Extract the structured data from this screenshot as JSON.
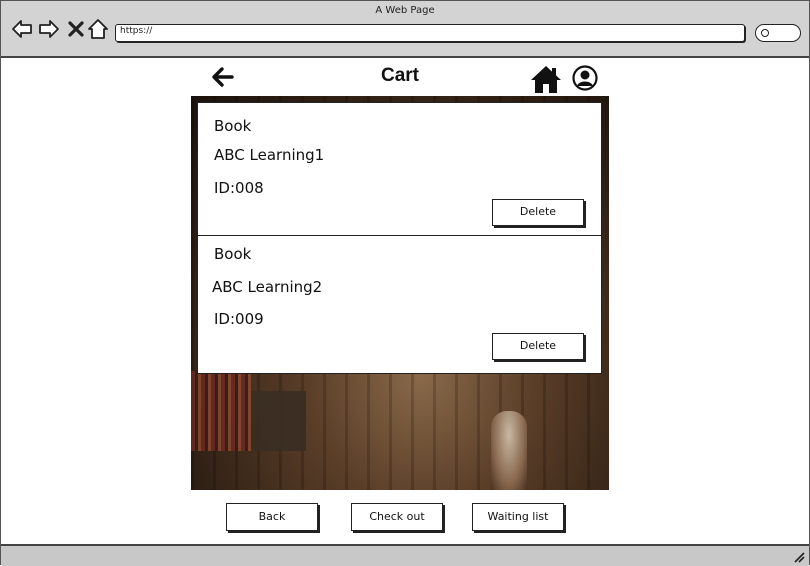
{
  "browser": {
    "window_title": "A Web Page",
    "url": "https://"
  },
  "page": {
    "title": "Cart"
  },
  "cart_items": [
    {
      "type": "Book",
      "name": "ABC Learning1",
      "id": "ID:008",
      "delete_label": "Delete"
    },
    {
      "type": "Book",
      "name": "ABC Learning2",
      "id": "ID:009",
      "delete_label": "Delete"
    }
  ],
  "footer": {
    "back_label": "Back",
    "checkout_label": "Check out",
    "waiting_label": "Waiting list"
  },
  "icons": {
    "nav_back": "back-arrow-icon",
    "home": "home-icon",
    "user": "user-account-icon"
  }
}
